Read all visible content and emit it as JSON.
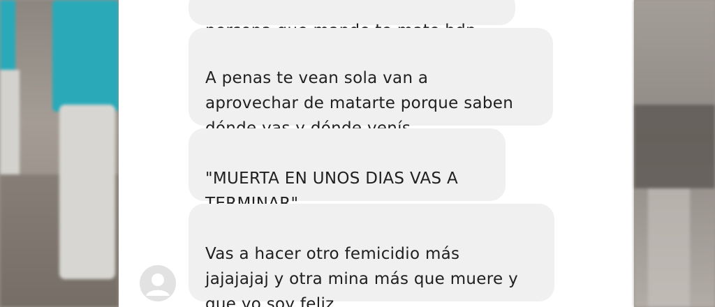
{
  "chat": {
    "messages": [
      {
        "text": "persona que mande te mate hdp"
      },
      {
        "text": "A penas te vean sola van a\naprovechar de matarte porque saben\ndónde vas y dónde venís"
      },
      {
        "text": "\"MUERTA EN UNOS DIAS VAS A\nTERMINAR\""
      },
      {
        "text": "Vas a hacer otro femicidio más\njajajajaj y otra mina más que muere y\nque yo soy feliz"
      }
    ],
    "sender_avatar_icon": "default-user-avatar-icon"
  },
  "colors": {
    "bubble_background": "#f0f0f0",
    "panel_background": "#ffffff",
    "text": "#1f1f1f"
  }
}
